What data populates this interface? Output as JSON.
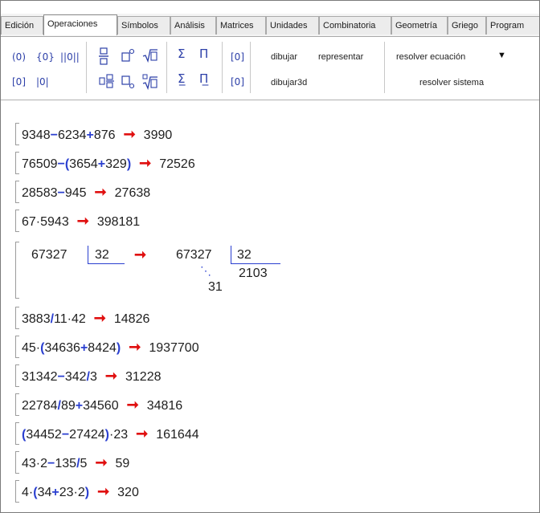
{
  "tabs": [
    "Edición",
    "Operaciones",
    "Símbolos",
    "Análisis",
    "Matrices",
    "Unidades",
    "Combinatoria",
    "Geometría",
    "Griego",
    "Program"
  ],
  "toolbar": {
    "icons_row1": [
      "(0)",
      "{0}",
      "||0||",
      "fraction-icon",
      "power-icon",
      "sqrt-icon",
      "sum-icon",
      "product-icon",
      "[0]"
    ],
    "icons_row2": [
      "[0]",
      "|0|",
      "mixed-icon",
      "subscript-icon",
      "nthroot-icon",
      "sum-limits-icon",
      "product-limits-icon",
      "[0]"
    ],
    "dibujar": "dibujar",
    "representar": "representar",
    "dibujar3d": "dibujar3d",
    "resolver_ecuacion": "resolver ecuación",
    "resolver_sistema": "resolver sistema"
  },
  "rows": [
    {
      "expr": [
        {
          "t": "9348"
        },
        {
          "o": "−"
        },
        {
          "t": "6234"
        },
        {
          "o": "+"
        },
        {
          "t": "876"
        }
      ],
      "result": "3990"
    },
    {
      "expr": [
        {
          "t": "76509"
        },
        {
          "o": "−"
        },
        {
          "o": "("
        },
        {
          "t": "3654"
        },
        {
          "o": "+"
        },
        {
          "t": "329"
        },
        {
          "o": ")"
        }
      ],
      "result": "72526"
    },
    {
      "expr": [
        {
          "t": "28583"
        },
        {
          "o": "−"
        },
        {
          "t": "945"
        }
      ],
      "result": "27638"
    },
    {
      "expr": [
        {
          "t": "67"
        },
        {
          "t": "·"
        },
        {
          "t": "5943"
        }
      ],
      "result": "398181"
    },
    {
      "expr": [
        {
          "t": "3883"
        },
        {
          "o": "/"
        },
        {
          "t": "11"
        },
        {
          "t": "·"
        },
        {
          "t": "42"
        }
      ],
      "result": "14826"
    },
    {
      "expr": [
        {
          "t": "45"
        },
        {
          "t": "·"
        },
        {
          "o": "("
        },
        {
          "t": "34636"
        },
        {
          "o": "+"
        },
        {
          "t": "8424"
        },
        {
          "o": ")"
        }
      ],
      "result": "1937700"
    },
    {
      "expr": [
        {
          "t": "31342"
        },
        {
          "o": "−"
        },
        {
          "t": "342"
        },
        {
          "o": "/"
        },
        {
          "t": "3"
        }
      ],
      "result": "31228"
    },
    {
      "expr": [
        {
          "t": "22784"
        },
        {
          "o": "/"
        },
        {
          "t": "89"
        },
        {
          "o": "+"
        },
        {
          "t": "34560"
        }
      ],
      "result": "34816"
    },
    {
      "expr": [
        {
          "o": "("
        },
        {
          "t": "34452"
        },
        {
          "o": "−"
        },
        {
          "t": "27424"
        },
        {
          "o": ")"
        },
        {
          "t": "·"
        },
        {
          "t": "23"
        }
      ],
      "result": "161644"
    },
    {
      "expr": [
        {
          "t": "43"
        },
        {
          "t": "·"
        },
        {
          "t": "2"
        },
        {
          "o": "−"
        },
        {
          "t": "135"
        },
        {
          "o": "/"
        },
        {
          "t": "5"
        }
      ],
      "result": "59"
    },
    {
      "expr": [
        {
          "t": "4"
        },
        {
          "t": "·"
        },
        {
          "o": "("
        },
        {
          "t": "34"
        },
        {
          "o": "+"
        },
        {
          "t": "23"
        },
        {
          "t": "·"
        },
        {
          "t": "2"
        },
        {
          "o": ")"
        }
      ],
      "result": "320"
    }
  ],
  "division": {
    "dividend": "67327",
    "divisor": "32",
    "dividend_result": "67327",
    "divisor_result": "32",
    "quotient": "2103",
    "remainder": "31",
    "dots": "⋱"
  },
  "colors": {
    "operator": "#2a3fd0",
    "arrow": "#e01010",
    "text": "#1e1e1e"
  }
}
